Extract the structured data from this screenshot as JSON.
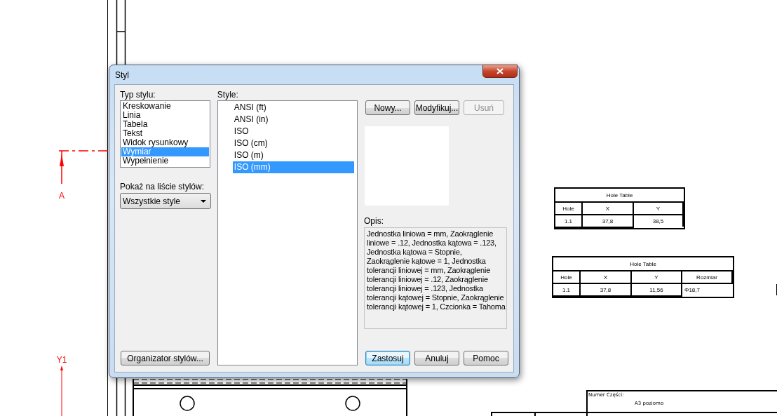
{
  "drawing": {
    "section_marker": {
      "label": "A"
    },
    "axis_marker": {
      "label": "Y1"
    },
    "hole_tables": [
      {
        "title": "Hole Table",
        "columns": [
          "Hole",
          "X",
          "Y"
        ],
        "rows": [
          [
            "1.1",
            "37,8",
            "38,5"
          ]
        ]
      },
      {
        "title": "Hole Table",
        "columns": [
          "Hole",
          "X",
          "Y",
          "Rozmiar"
        ],
        "rows": [
          [
            "1.1",
            "37,8",
            "11,56",
            "Φ18,7"
          ]
        ]
      }
    ],
    "title_block": {
      "label": "Numer Części:",
      "value": "A3 poziomo"
    }
  },
  "dialog": {
    "title": "Styl",
    "style_type": {
      "label": "Typ stylu:",
      "items": [
        {
          "label": "Kreskowanie",
          "selected": false
        },
        {
          "label": "Linia",
          "selected": false
        },
        {
          "label": "Tabela",
          "selected": false
        },
        {
          "label": "Tekst",
          "selected": false
        },
        {
          "label": "Widok rysunkowy",
          "selected": false
        },
        {
          "label": "Wymiar",
          "selected": true
        },
        {
          "label": "Wypełnienie",
          "selected": false
        }
      ]
    },
    "show_in_list": {
      "label": "Pokaż na liście stylów:",
      "value": "Wszystkie style"
    },
    "organizer_button": "Organizator stylów...",
    "styles": {
      "label": "Style:",
      "items": [
        {
          "label": "ANSI (ft)",
          "selected": false
        },
        {
          "label": "ANSI (in)",
          "selected": false
        },
        {
          "label": "ISO",
          "selected": false
        },
        {
          "label": "ISO (cm)",
          "selected": false
        },
        {
          "label": "ISO (m)",
          "selected": false
        },
        {
          "label": "ISO (mm)",
          "selected": true
        }
      ]
    },
    "action_buttons": [
      {
        "label": "Nowy...",
        "disabled": false
      },
      {
        "label": "Modyfikuj...",
        "disabled": false
      },
      {
        "label": "Usuń",
        "disabled": true
      }
    ],
    "description": {
      "label": "Opis:",
      "text": "Jednostka liniowa = mm, Zaokrąglenie liniowe = .12, Jednostka kątowa = .123, Jednostka kątowa = Stopnie, Zaokrąglenie kątowe = 1, Jednostka tolerancji liniowej = mm, Zaokrąglenie tolerancji liniowej = .12, Zaokrąglenie tolerancji liniowej = .123, Jednostka tolerancji kątowej = Stopnie, Zaokrąglenie tolerancji kątowej = 1, Czcionka = Tahoma"
    },
    "footer_buttons": [
      {
        "label": "Zastosuj",
        "default": true
      },
      {
        "label": "Anuluj",
        "default": false
      },
      {
        "label": "Pomoc",
        "default": false
      }
    ]
  }
}
